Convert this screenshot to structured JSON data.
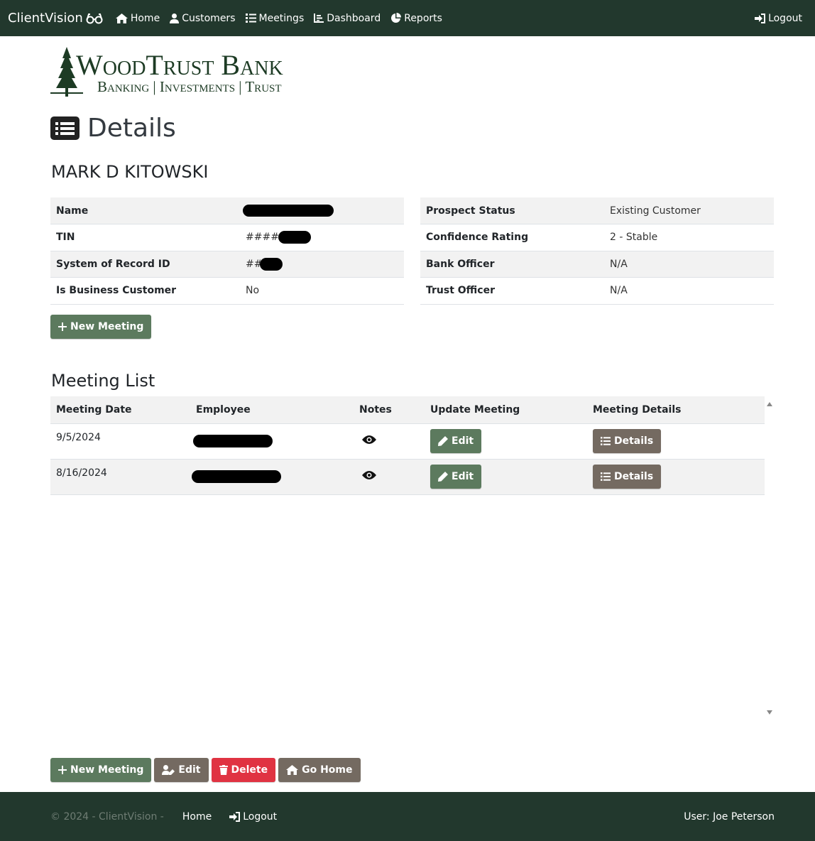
{
  "navbar": {
    "brand": "ClientVision",
    "items": [
      {
        "label": "Home",
        "icon": "home-icon"
      },
      {
        "label": "Customers",
        "icon": "user-icon"
      },
      {
        "label": "Meetings",
        "icon": "list-icon"
      },
      {
        "label": "Dashboard",
        "icon": "chart-icon"
      },
      {
        "label": "Reports",
        "icon": "pie-chart-icon"
      }
    ],
    "logout": "Logout"
  },
  "logo": {
    "title": "WoodTrust Bank",
    "subtitle": "Banking | Investments | Trust"
  },
  "page": {
    "title": "Details",
    "customer_name": "MARK D KITOWSKI"
  },
  "info_left": [
    {
      "label": "Name",
      "value": "",
      "redacted": true
    },
    {
      "label": "TIN",
      "value": "####",
      "redacted": true
    },
    {
      "label": "System of Record ID",
      "value": "##",
      "redacted": true
    },
    {
      "label": "Is Business Customer",
      "value": "No",
      "redacted": false
    }
  ],
  "info_right": [
    {
      "label": "Prospect Status",
      "value": "Existing Customer"
    },
    {
      "label": "Confidence Rating",
      "value": "2 - Stable"
    },
    {
      "label": "Bank Officer",
      "value": "N/A"
    },
    {
      "label": "Trust Officer",
      "value": "N/A"
    }
  ],
  "buttons": {
    "new_meeting": "New Meeting",
    "edit": "Edit",
    "details": "Details",
    "delete": "Delete",
    "go_home": "Go Home"
  },
  "meetings": {
    "heading": "Meeting List",
    "columns": [
      "Meeting Date",
      "Employee",
      "Notes",
      "Update Meeting",
      "Meeting Details"
    ],
    "rows": [
      {
        "date": "9/5/2024",
        "employee_redacted": true
      },
      {
        "date": "8/16/2024",
        "employee_redacted": true
      }
    ]
  },
  "footer": {
    "copyright": "© 2024 - ClientVision -",
    "home": "Home",
    "logout": "Logout",
    "user": "User: Joe Peterson"
  },
  "colors": {
    "navbar_bg": "#22382d",
    "primary_green": "#5c7a5e",
    "secondary_brown": "#746a61",
    "danger_red": "#e03342",
    "logo_green": "#1d3b24"
  }
}
